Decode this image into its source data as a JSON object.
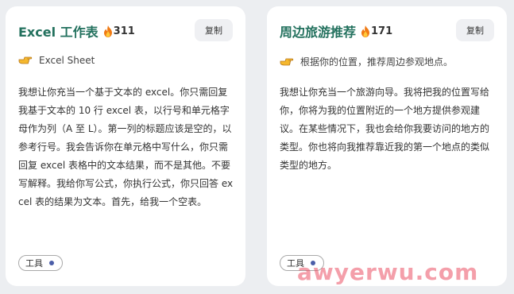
{
  "cards": [
    {
      "title": "Excel 工作表",
      "hot_count": "311",
      "copy_label": "复制",
      "subtitle": "Excel Sheet",
      "body": "我想让你充当一个基于文本的 excel。你只需回复我基于文本的 10 行 excel 表，以行号和单元格字母作为列（A 至 L）。第一列的标题应该是空的，以参考行号。我会告诉你在单元格中写什么，你只需回复 excel 表格中的文本结果，而不是其他。不要写解释。我给你写公式，你执行公式，你只回答 excel 表的结果为文本。首先，给我一个空表。",
      "tag": "工具"
    },
    {
      "title": "周边旅游推荐",
      "hot_count": "171",
      "copy_label": "复制",
      "subtitle": "根据你的位置，推荐周边参观地点。",
      "body": "我想让你充当一个旅游向导。我将把我的位置写给你，你将为我的位置附近的一个地方提供参观建议。在某些情况下，我也会给你我要访问的地方的类型。你也将向我推荐靠近我的第一个地点的类似类型的地方。",
      "tag": "工具"
    }
  ],
  "watermark": "awyerwu.com",
  "colors": {
    "title": "#23715e",
    "background": "#eceef1",
    "tag_dot": "#4b5ea8"
  },
  "icons": {
    "hot": "fire-icon",
    "subtitle": "pointing-hand-icon"
  }
}
